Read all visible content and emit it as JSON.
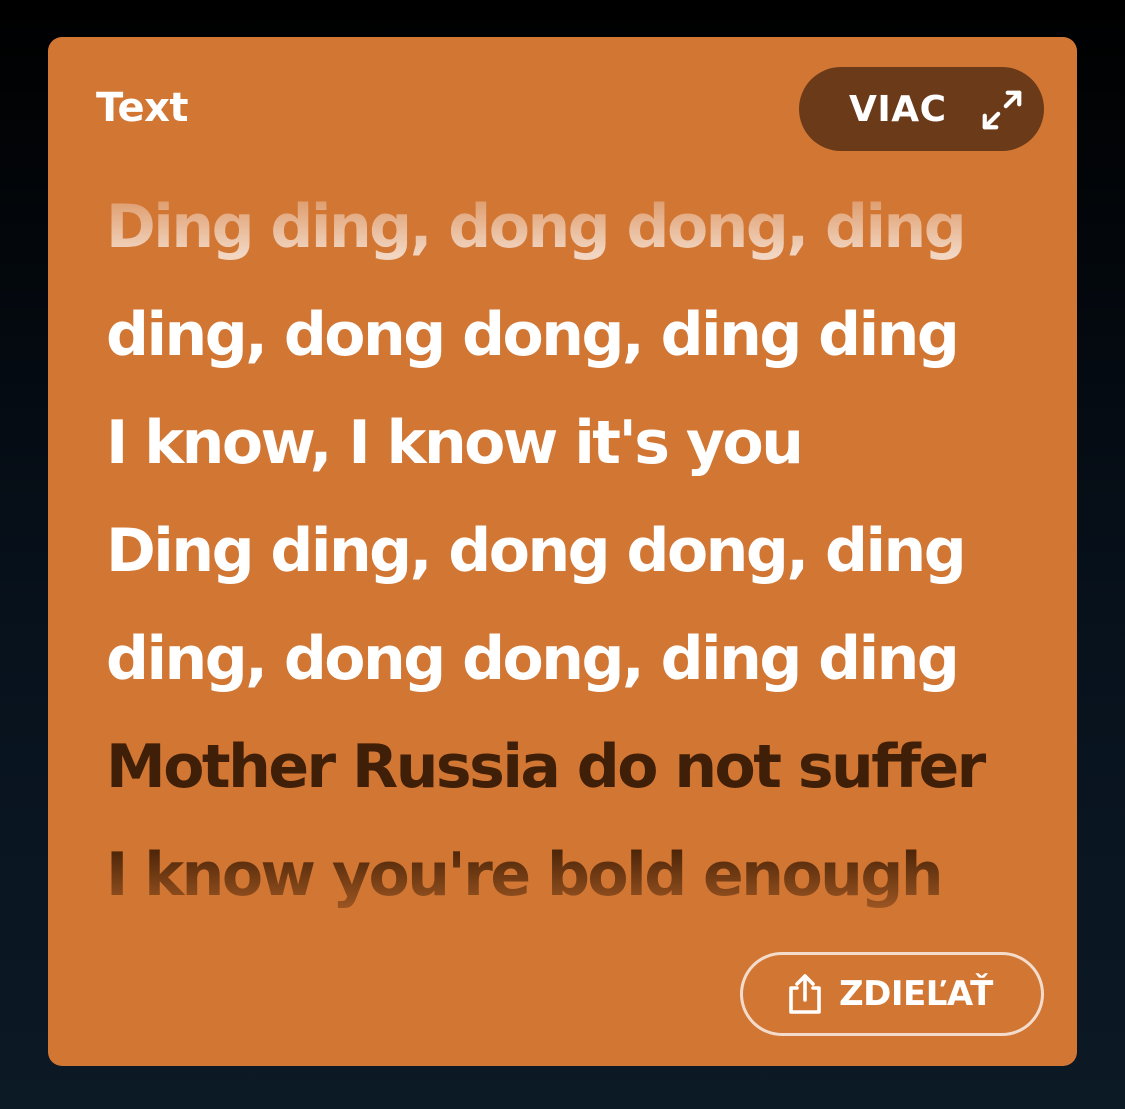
{
  "card": {
    "title": "Text",
    "background_color": "#d27634"
  },
  "more_button": {
    "label": "VIAC",
    "icon": "expand-icon",
    "background_color": "#6b3a18"
  },
  "lyrics": {
    "lines": [
      {
        "text": "Ding ding, dong dong, ding",
        "state": "past"
      },
      {
        "text": "ding, dong dong, ding ding",
        "state": "past"
      },
      {
        "text": "I know, I know it's you",
        "state": "past"
      },
      {
        "text": "Ding ding, dong dong, ding",
        "state": "past"
      },
      {
        "text": "ding, dong dong, ding ding",
        "state": "past"
      },
      {
        "text": "Mother Russia do not suffer",
        "state": "current"
      },
      {
        "text": "I know you're bold enough",
        "state": "upcoming"
      }
    ],
    "current_color": "#3f1f07"
  },
  "share_button": {
    "label": "ZDIEĽAŤ",
    "icon": "share-icon"
  }
}
